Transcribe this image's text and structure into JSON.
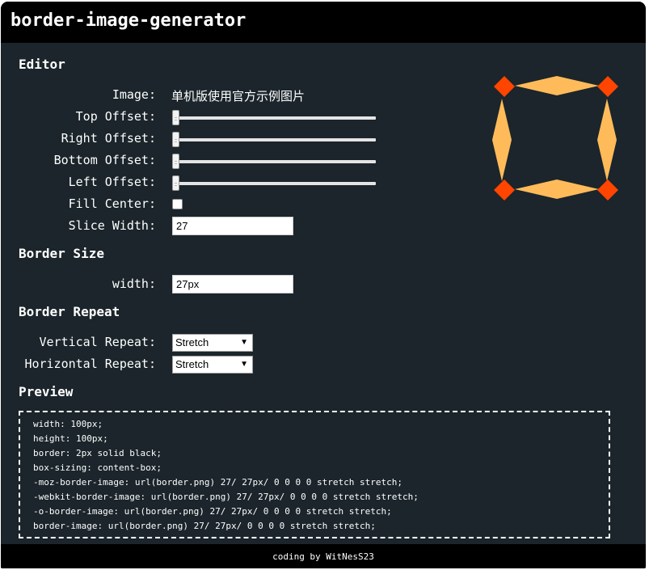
{
  "app": {
    "title": "border-image-generator"
  },
  "editor": {
    "heading": "Editor",
    "image_label": "Image:",
    "image_value": "单机版使用官方示例图片",
    "top_offset_label": "Top Offset:",
    "top_offset_value": 0,
    "right_offset_label": "Right Offset:",
    "right_offset_value": 0,
    "bottom_offset_label": "Bottom Offset:",
    "bottom_offset_value": 0,
    "left_offset_label": "Left Offset:",
    "left_offset_value": 0,
    "fill_center_label": "Fill Center:",
    "fill_center_checked": false,
    "slice_width_label": "Slice Width:",
    "slice_width_value": "27",
    "preview_image_colors": {
      "corner": "#ff4500",
      "edge": "#ffbb5a"
    }
  },
  "border_size": {
    "heading": "Border Size",
    "width_label": "width:",
    "width_value": "27px"
  },
  "border_repeat": {
    "heading": "Border Repeat",
    "vertical_label": "Vertical Repeat:",
    "vertical_value": "Stretch",
    "horizontal_label": "Horizontal Repeat:",
    "horizontal_value": "Stretch"
  },
  "preview": {
    "heading": "Preview",
    "lines": [
      "width: 100px;",
      "height: 100px;",
      "border: 2px solid black;",
      "box-sizing: content-box;",
      "-moz-border-image: url(border.png) 27/ 27px/ 0 0 0 0 stretch stretch;",
      "-webkit-border-image: url(border.png) 27/ 27px/ 0 0 0 0 stretch stretch;",
      "-o-border-image: url(border.png) 27/ 27px/ 0 0 0 0 stretch stretch;",
      "border-image: url(border.png) 27/ 27px/ 0 0 0 0 stretch stretch;"
    ]
  },
  "footer": {
    "text": "coding by WitNesS23"
  },
  "colors": {
    "background": "#1b252b",
    "bar": "#000000",
    "text": "#ffffff"
  }
}
